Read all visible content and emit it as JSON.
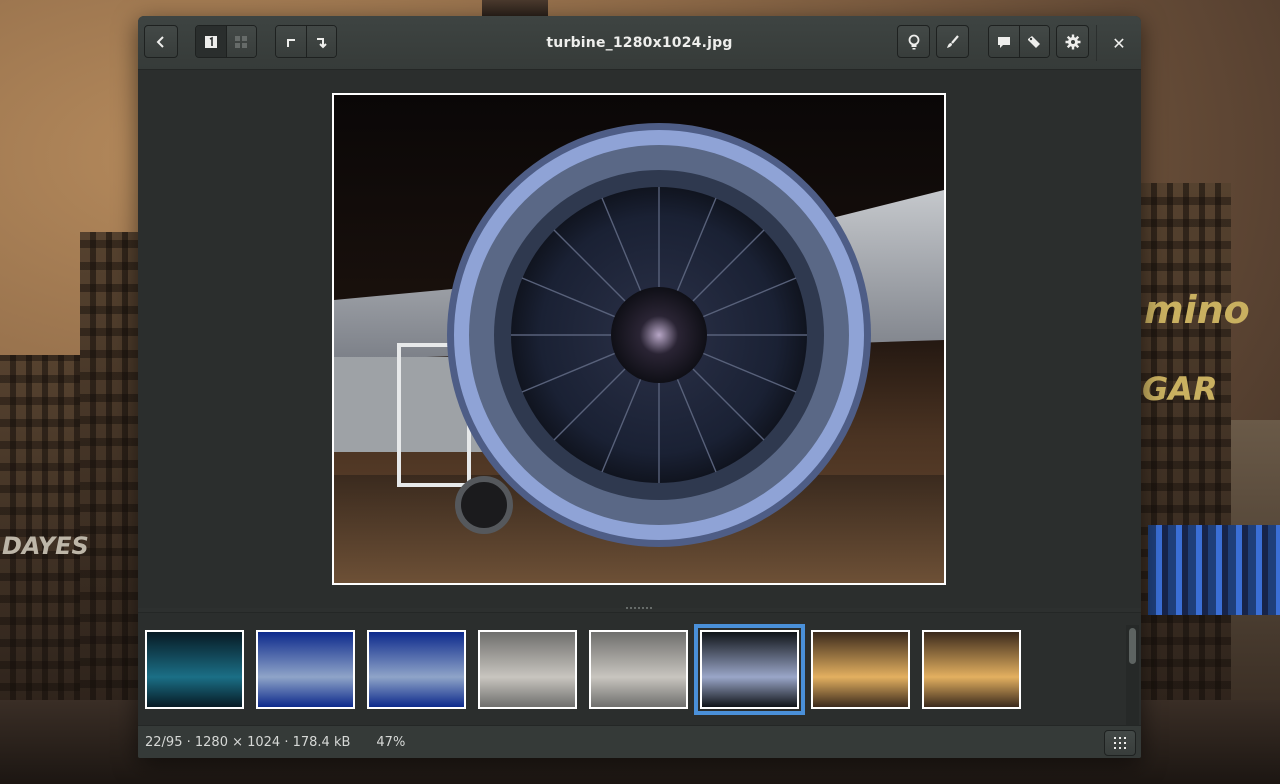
{
  "window": {
    "title": "turbine_1280x1024.jpg"
  },
  "headerbar": {
    "back_icon": "chevron-left-icon",
    "view_single_icon": "single-view-icon",
    "view_grid_icon": "grid-view-icon",
    "rotate_left_icon": "rotate-left-icon",
    "rotate_right_icon": "rotate-right-icon",
    "lightbulb_icon": "lightbulb-icon",
    "edit_icon": "brush-icon",
    "comment_icon": "comment-icon",
    "tag_icon": "tag-icon",
    "settings_icon": "gear-icon",
    "close_label": "✕"
  },
  "backdrop": {
    "sign_left": "DAYES",
    "sign_right_1": "mino",
    "sign_right_2": "GAR"
  },
  "thumbnails": [
    {
      "name": "space-nebula",
      "colors": [
        "#071a24",
        "#1b6f86"
      ],
      "selected": false
    },
    {
      "name": "airliner-blue-sky",
      "colors": [
        "#0d2a8c",
        "#8fa4c8"
      ],
      "selected": false
    },
    {
      "name": "airliner-blue-sky-2",
      "colors": [
        "#0d2a8c",
        "#8fa4c8"
      ],
      "selected": false
    },
    {
      "name": "airliner-cloudy",
      "colors": [
        "#6f6f6d",
        "#c8c5bf"
      ],
      "selected": false
    },
    {
      "name": "airliner-cloudy-2",
      "colors": [
        "#6f6f6d",
        "#c8c5bf"
      ],
      "selected": false
    },
    {
      "name": "turbine",
      "colors": [
        "#101418",
        "#9aa6c8"
      ],
      "selected": true
    },
    {
      "name": "city-sunset",
      "colors": [
        "#3b2a1c",
        "#e3b060"
      ],
      "selected": false
    },
    {
      "name": "city-sunset-2",
      "colors": [
        "#3b2a1c",
        "#e3b060"
      ],
      "selected": false
    }
  ],
  "status": {
    "position": "22/95",
    "dot1": " · ",
    "dimensions": "1280 × 1024",
    "dot2": " · ",
    "filesize": "178.4 kB",
    "zoom": "47%"
  },
  "colors": {
    "selection": "#4a90d9",
    "window_bg": "#2d302f"
  }
}
